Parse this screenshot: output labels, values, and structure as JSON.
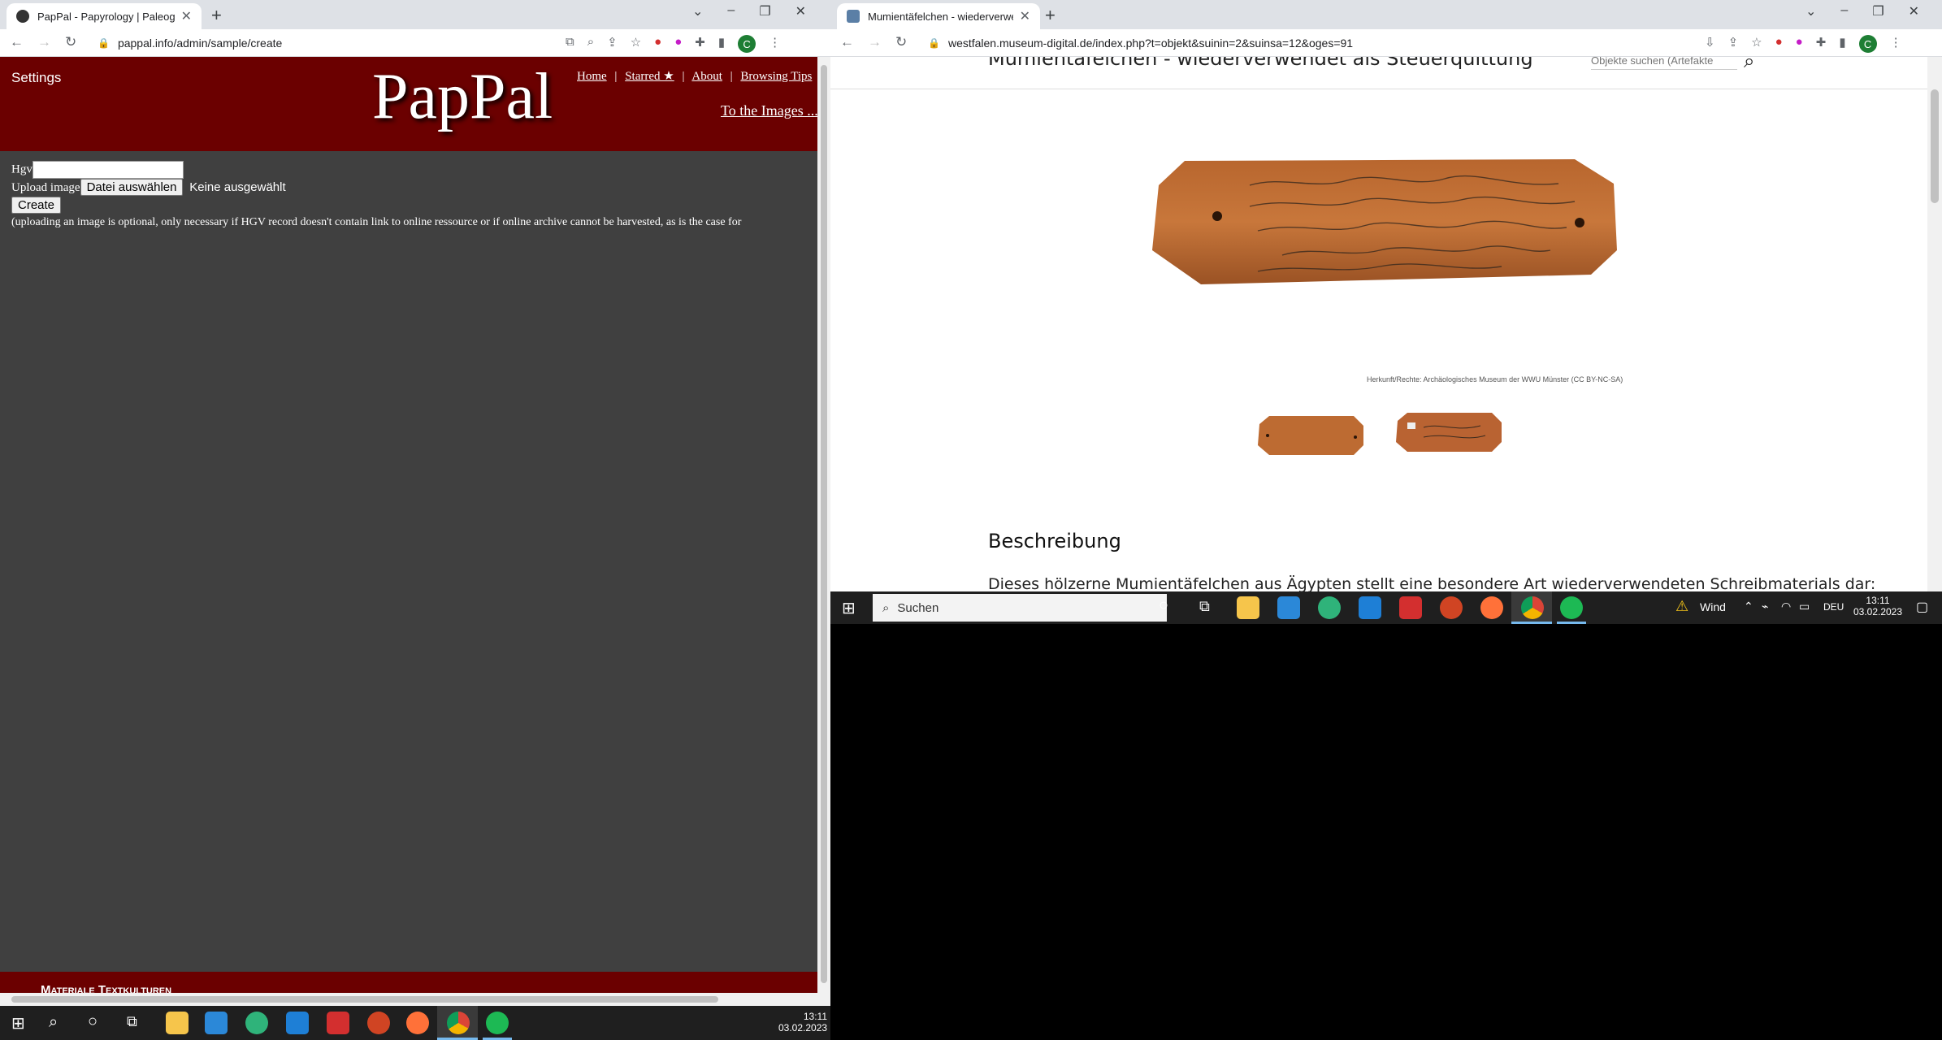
{
  "left_window": {
    "tab_title": "PapPal - Papyrology | Paleograph",
    "url": "pappal.info/admin/sample/create",
    "page": {
      "settings_label": "Settings",
      "logo": "PapPal",
      "nav": [
        "Home",
        "Starred ★",
        "About",
        "Browsing Tips"
      ],
      "nav_sep": "|",
      "to_images": "To the Images ...",
      "form": {
        "hgv_label": "Hgv",
        "hgv_value": "",
        "upload_label": "Upload image",
        "file_button": "Datei auswählen",
        "file_status": "Keine ausgewählt",
        "create_button": "Create",
        "note": "(uploading an image is optional, only necessary if HGV record doesn't contain link to online ressource or if online archive cannot be harvested, as is the case for"
      },
      "footer_text": "Materiale Textkulturen"
    },
    "colors": {
      "header_bg": "#6b0000",
      "body_bg": "#404040"
    }
  },
  "right_window": {
    "tab_title": "Mumientäfelchen - wiederverwe",
    "url": "westfalen.museum-digital.de/index.php?t=objekt&suinin=2&suinsa=12&oges=91",
    "page": {
      "heading": "Mumientäfelchen - wiederverwendet als Steuerquittung",
      "search_placeholder": "Objekte suchen (Artefakte",
      "image_caption": "Herkunft/Rechte: Archäologisches Museum der WWU Münster (CC BY-NC-SA)",
      "section_title": "Beschreibung",
      "description": "Dieses hölzerne Mumientäfelchen aus Ägypten stellt eine besondere Art wiederverwendeten Schreibmaterials dar:"
    }
  },
  "taskbar_small": {
    "search_placeholder": "Suchen",
    "weather": "Wind",
    "lang": "DEU",
    "time": "13:11",
    "date": "03.02.2023"
  },
  "taskbar_main": {
    "time": "13:11",
    "date": "03.02.2023"
  }
}
